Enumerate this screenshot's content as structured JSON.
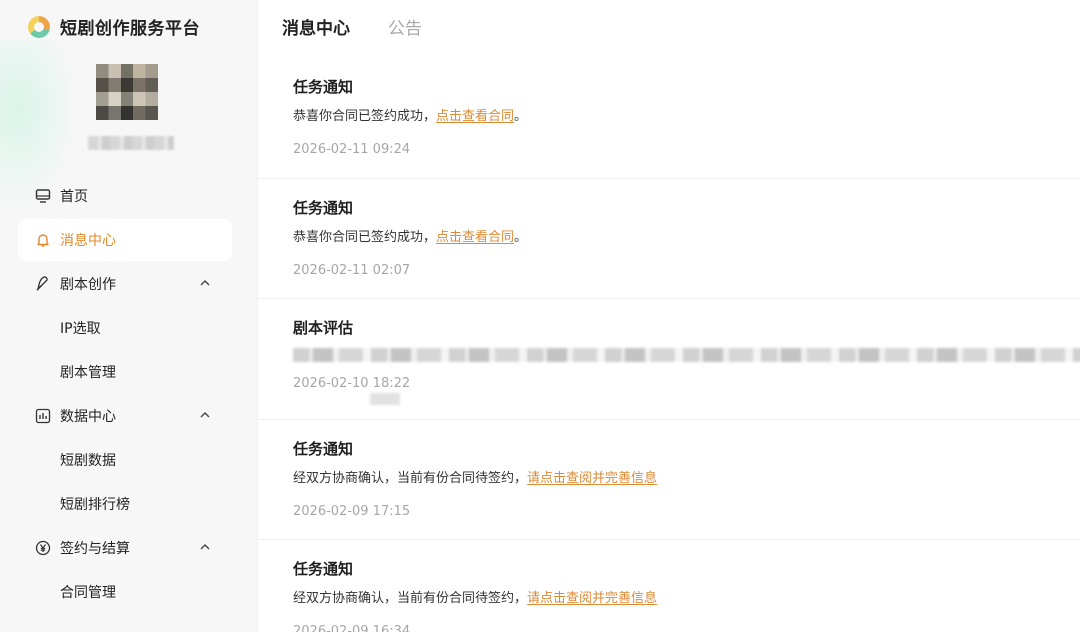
{
  "brand": {
    "title": "短剧创作服务平台"
  },
  "sidebar": {
    "items": [
      {
        "label": "首页",
        "icon": "monitor-icon",
        "active": false,
        "type": "top"
      },
      {
        "label": "消息中心",
        "icon": "bell-icon",
        "active": true,
        "type": "top"
      },
      {
        "label": "剧本创作",
        "icon": "feather-icon",
        "active": false,
        "type": "group",
        "expanded": true
      },
      {
        "label": "IP选取",
        "type": "sub"
      },
      {
        "label": "剧本管理",
        "type": "sub"
      },
      {
        "label": "数据中心",
        "icon": "chart-icon",
        "active": false,
        "type": "group",
        "expanded": true
      },
      {
        "label": "短剧数据",
        "type": "sub"
      },
      {
        "label": "短剧排行榜",
        "type": "sub"
      },
      {
        "label": "签约与结算",
        "icon": "yen-icon",
        "active": false,
        "type": "group",
        "expanded": true
      },
      {
        "label": "合同管理",
        "type": "sub"
      }
    ],
    "accent_color": "#e08a2c"
  },
  "tabs": [
    {
      "label": "消息中心",
      "active": true
    },
    {
      "label": "公告",
      "active": false
    }
  ],
  "messages": [
    {
      "title": "任务通知",
      "text": "恭喜你合同已签约成功，",
      "link": "点击查看合同",
      "tail": "。",
      "time": "2026-02-11 09:24"
    },
    {
      "title": "任务通知",
      "text": "恭喜你合同已签约成功，",
      "link": "点击查看合同",
      "tail": "。",
      "time": "2026-02-11 02:07"
    },
    {
      "title": "剧本评估",
      "text": "",
      "link": "",
      "tail": "",
      "time": "2026-02-10 18:22"
    },
    {
      "title": "任务通知",
      "text": "经双方协商确认，当前有份合同待签约，",
      "link": "请点击查阅并完善信息",
      "tail": "",
      "time": "2026-02-09 17:15"
    },
    {
      "title": "任务通知",
      "text": "经双方协商确认，当前有份合同待签约，",
      "link": "请点击查阅并完善信息",
      "tail": "",
      "time": "2026-02-09 16:34"
    }
  ]
}
